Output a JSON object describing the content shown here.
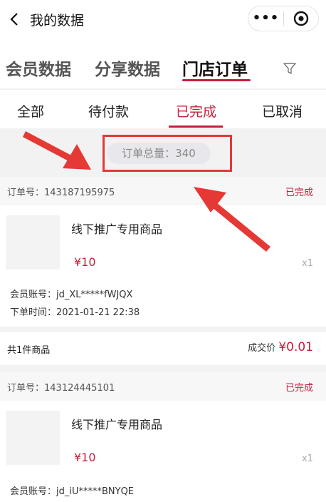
{
  "header": {
    "title": "我的数据",
    "more_label": "•••"
  },
  "main_tabs": [
    {
      "label": "会员数据"
    },
    {
      "label": "分享数据"
    },
    {
      "label": "门店订单"
    }
  ],
  "main_tab_active": "门店订单",
  "status_tabs": [
    {
      "label": "全部"
    },
    {
      "label": "待付款"
    },
    {
      "label": "已完成"
    },
    {
      "label": "已取消"
    }
  ],
  "status_tab_active": "已完成",
  "summary": {
    "text": "订单总量：340"
  },
  "orders": [
    {
      "order_no": "订单号：143187195975",
      "status": "已完成",
      "product_name": "线下推广专用商品",
      "price": "¥10",
      "qty": "x1",
      "member": "会员账号：jd_XL*****fWJQX",
      "order_time": "下单时间：2021-01-21 22:38",
      "count_text": "共1件商品",
      "deal_label": "成交价",
      "deal_amount": "¥0.01"
    },
    {
      "order_no": "订单号：143124445101",
      "status": "已完成",
      "product_name": "线下推广专用商品",
      "price": "¥10",
      "qty": "x1",
      "member": "会员账号：jd_iU*****BNYQE"
    }
  ],
  "colors": {
    "accent": "#c81e3c",
    "annotation": "#e53935"
  },
  "icons": {
    "back": "chevron-left-icon",
    "more": "more-dots-icon",
    "target": "target-icon",
    "filter": "funnel-icon"
  }
}
